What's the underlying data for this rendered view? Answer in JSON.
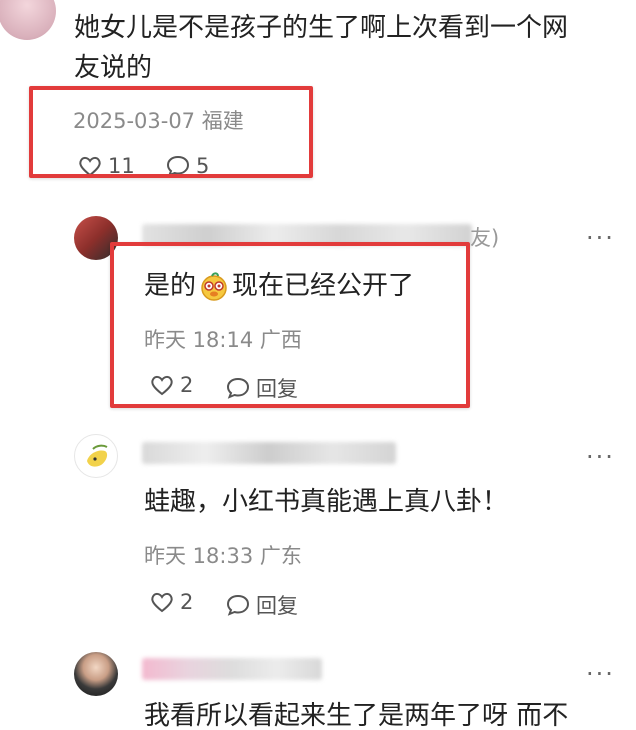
{
  "comment1": {
    "line1": "她女儿是不是孩子的生了啊上次看到一个网",
    "line2": "友说的",
    "meta": "2025-03-07 福建",
    "likes": "11",
    "replies": "5"
  },
  "reply1": {
    "username_tail": "友)",
    "text_pre": "是的",
    "text_post": "现在已经公开了",
    "meta": "昨天 18:14 广西",
    "likes": "2",
    "reply_label": "回复",
    "more": "···"
  },
  "reply2": {
    "text": "蛙趣，小红书真能遇上真八卦！",
    "meta": "昨天 18:33 广东",
    "likes": "2",
    "reply_label": "回复",
    "more": "···"
  },
  "reply3": {
    "text": "我看所以看起来生了是两年了呀 而不",
    "more": "···"
  },
  "colors": {
    "highlight_box": "#e23b3b"
  }
}
